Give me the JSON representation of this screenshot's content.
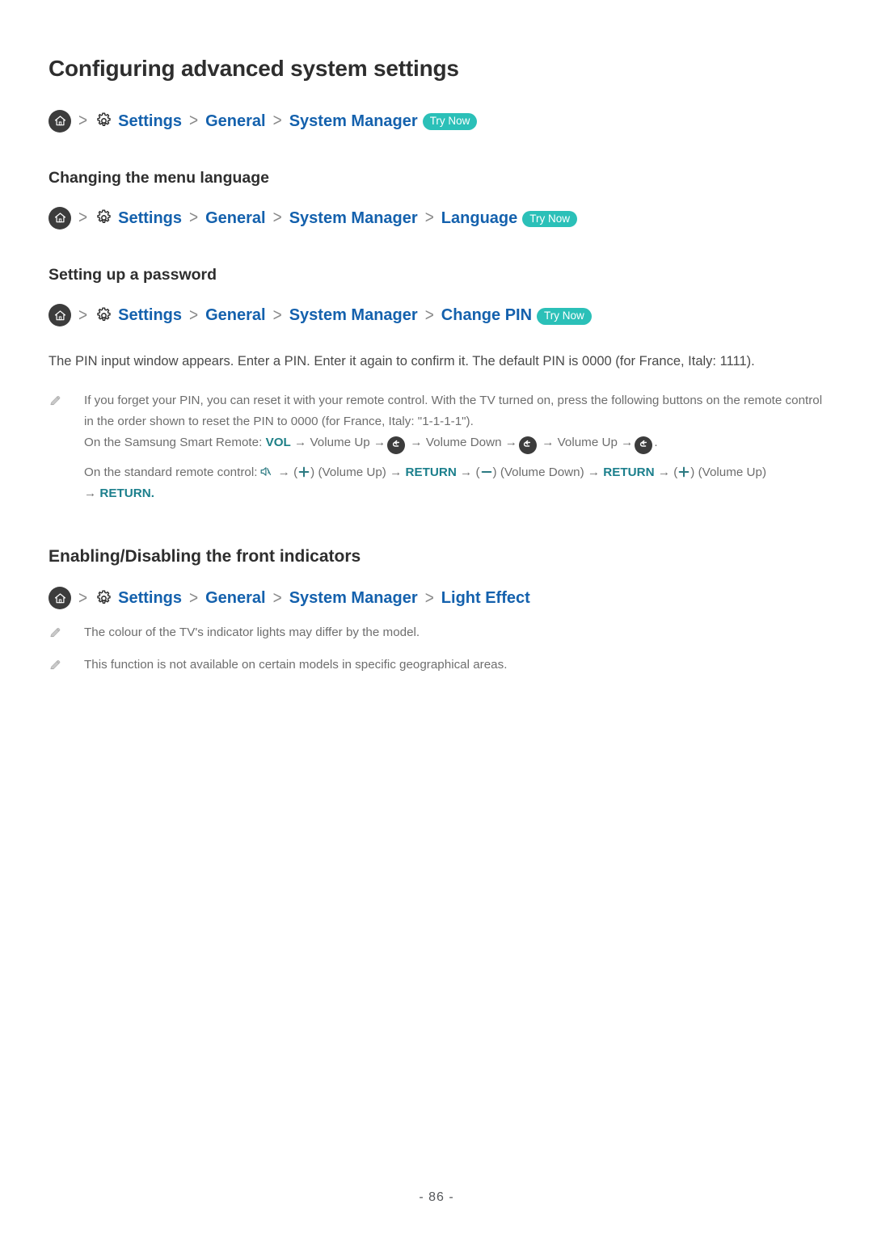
{
  "document": {
    "title": "Configuring advanced system settings",
    "page_number": "- 86 -"
  },
  "icons": {
    "home": "home-icon",
    "gear": "gear-icon",
    "pencil": "pencil-note-icon",
    "return": "return-arrow-icon",
    "mute": "mute-icon",
    "volume_up": "plus-icon",
    "volume_down": "minus-icon"
  },
  "colors": {
    "link_blue": "#1461ad",
    "teal_accent": "#1d7f86",
    "badge_teal": "#2bc0b8",
    "body_text": "#4a4a4a",
    "note_text": "#6e6e6e",
    "heading": "#2e2e2e"
  },
  "separator": ">",
  "badge": {
    "try_now": "Try Now"
  },
  "sections": [
    {
      "id": "advanced-system-settings",
      "heading": "Configuring advanced system settings",
      "breadcrumb": {
        "crumbs": [
          "Settings",
          "General",
          "System Manager"
        ],
        "has_try_now": true
      }
    },
    {
      "id": "changing-menu-language",
      "heading": "Changing the menu language",
      "breadcrumb": {
        "crumbs": [
          "Settings",
          "General",
          "System Manager",
          "Language"
        ],
        "has_try_now": true
      }
    },
    {
      "id": "setting-up-password",
      "heading": "Setting up a password",
      "breadcrumb": {
        "crumbs": [
          "Settings",
          "General",
          "System Manager",
          "Change PIN"
        ],
        "has_try_now": true
      },
      "paragraph": "The PIN input window appears. Enter a PIN. Enter it again to confirm it. The default PIN is 0000 (for France, Italy: 1111).",
      "notes": [
        {
          "lines": [
            "If you forget your PIN, you can reset it with your remote control. With the TV turned on, press the following buttons on the remote control in the order shown to reset the PIN to 0000 (for France, Italy: \"1-1-1-1\")."
          ],
          "smart_remote": {
            "prefix": "On the Samsung Smart Remote:",
            "vol_label": "VOL",
            "steps": [
              "Volume Up",
              "Volume Down",
              "Volume Up"
            ],
            "trailing": "."
          },
          "standard_remote": {
            "prefix": "On the standard remote control:",
            "volume_up_label": "(Volume Up)",
            "volume_down_label": "(Volume Down)",
            "return_label": "RETURN",
            "final_return": "RETURN."
          }
        }
      ]
    },
    {
      "id": "front-indicators",
      "heading": "Enabling/Disabling the front indicators",
      "breadcrumb": {
        "crumbs": [
          "Settings",
          "General",
          "System Manager",
          "Light Effect"
        ],
        "has_try_now": false
      },
      "notes": [
        {
          "text": "The colour of the TV's indicator lights may differ by the model."
        },
        {
          "text": "This function is not available on certain models in specific geographical areas."
        }
      ]
    }
  ]
}
